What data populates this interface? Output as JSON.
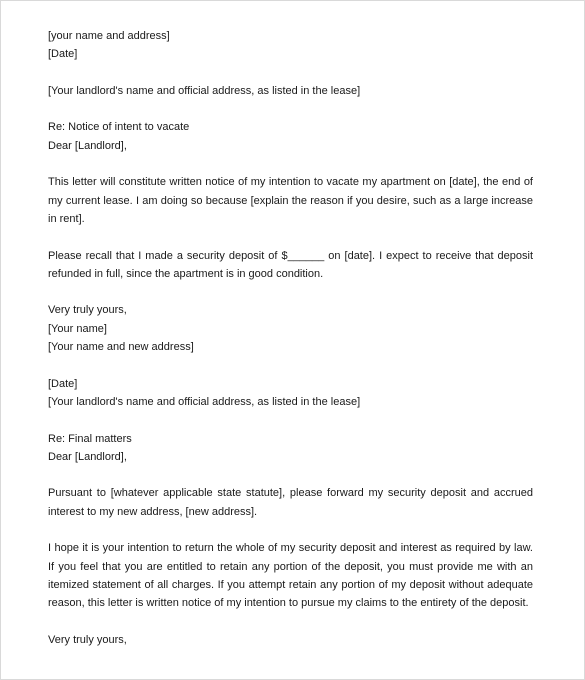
{
  "letter": {
    "sender_address": "[your name and address]",
    "date_1": "[Date]",
    "landlord_address_1": "[Your landlord's name and official address, as listed in the lease]",
    "subject_1": "Re: Notice of intent to vacate",
    "salutation_1": "Dear [Landlord],",
    "para_1": "This letter will constitute written notice of my intention to vacate my apartment on [date], the end of my current lease. I am doing so because [explain the reason if you desire, such as a large increase in rent].",
    "para_2": "Please recall that I made a security deposit of $______ on [date]. I expect to receive that deposit refunded in full, since the apartment is in good condition.",
    "closing_1": "Very truly yours,",
    "signature_name": "[Your name]",
    "signature_address": "[Your name and new address]",
    "date_2": "[Date]",
    "landlord_address_2": "[Your landlord's name and official address, as listed in the lease]",
    "subject_2": "Re: Final matters",
    "salutation_2": "Dear [Landlord],",
    "para_3": "Pursuant to [whatever applicable state statute], please forward my security deposit and accrued interest to my new address, [new address].",
    "para_4": "I hope it is your intention to return the whole of my security deposit and interest as required by law. If you feel that you are entitled to retain any portion of the deposit, you must provide me with an itemized statement of all charges. If you attempt retain any portion of my deposit without adequate reason, this letter is written notice of my intention to pursue my claims to the entirety of the deposit.",
    "closing_2": "Very truly yours,"
  }
}
